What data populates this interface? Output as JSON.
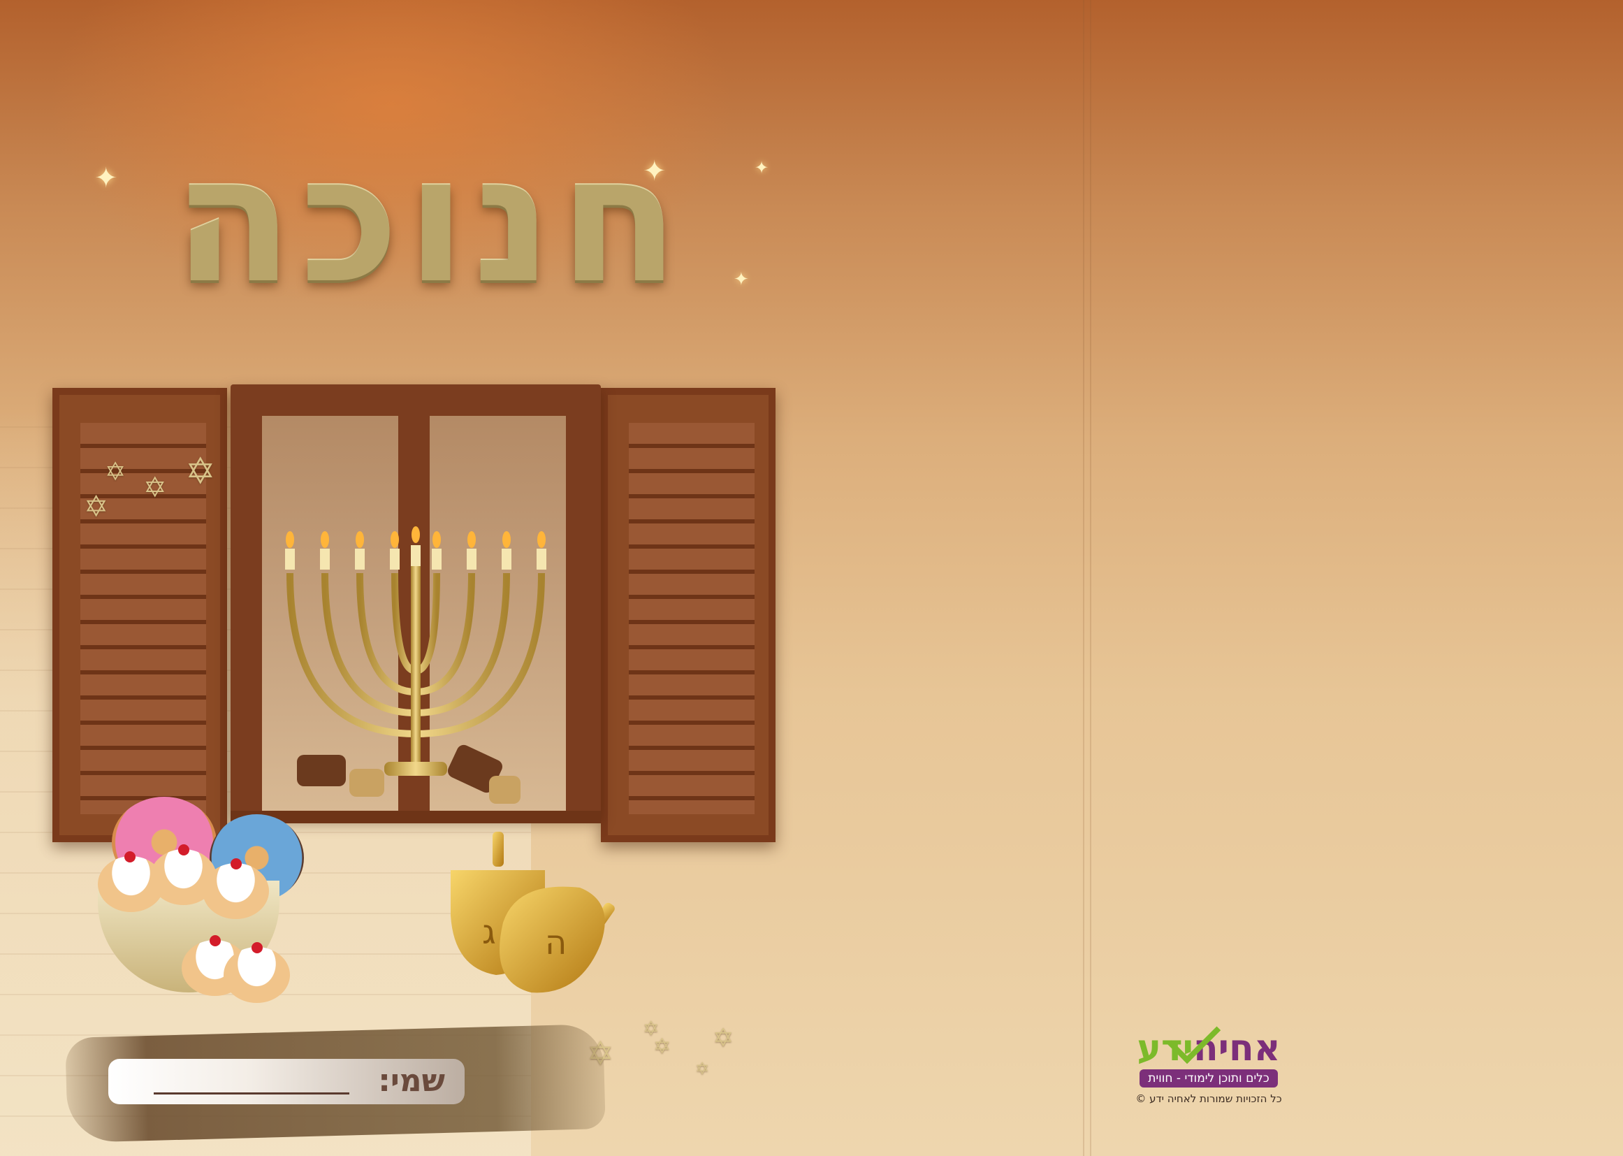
{
  "title": "חנוכה",
  "name_field": {
    "label": "שמי:"
  },
  "logo": {
    "brand_part1": "אחיה",
    "brand_part2": "ידע",
    "tagline": "כלים ותוכן לימודי - חווית",
    "copyright": "כל הזכויות שמורות לאחיה ידע ©"
  },
  "dreidel_letters": [
    "ג",
    "ה"
  ],
  "icons": [
    "menorah-icon",
    "window-icon",
    "shutter-icon",
    "dreidel-icon",
    "sufganiya-icon",
    "donut-icon",
    "star-of-david-icon",
    "sparkle-icon"
  ],
  "colors": {
    "title_gold": "#b9a56a",
    "wood_brown": "#8b4a25",
    "logo_purple": "#7c2f7a",
    "logo_green": "#7cba2a"
  }
}
